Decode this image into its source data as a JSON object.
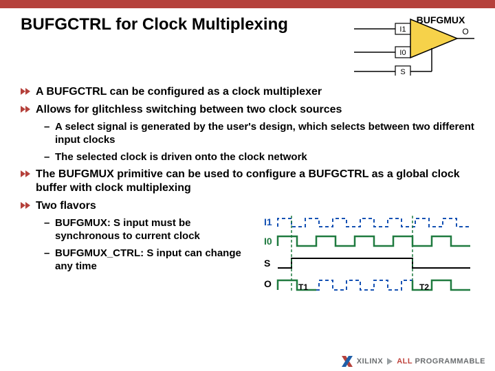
{
  "header": {
    "title": "BUFGCTRL for Clock Multiplexing"
  },
  "mux": {
    "label": "BUFGMUX",
    "i1": "I1",
    "i0": "I0",
    "o": "O",
    "s": "S"
  },
  "bullets": {
    "b1": "A BUFGCTRL can be configured as a clock multiplexer",
    "b2": "Allows for glitchless switching between two clock sources",
    "b2s1": "A select signal is generated by the user's design, which selects between two different input clocks",
    "b2s2": "The selected clock is driven onto the clock network",
    "b3": "The BUFGMUX primitive can be used to configure a BUFGCTRL as a global clock buffer with  clock multiplexing",
    "b4": "Two flavors",
    "b4s1": "BUFGMUX: S input must be synchronous to current clock",
    "b4s2": "BUFGMUX_CTRL: S input can change any time"
  },
  "timing": {
    "i1": "I1",
    "i0": "I0",
    "s": "S",
    "o": "O",
    "t1": "T1",
    "t2": "T2"
  },
  "footer": {
    "brand": "XILINX",
    "tag_prefix": "ALL",
    "tag_suffix": "PROGRAMMABLE"
  },
  "colors": {
    "accent": "#b5413b",
    "timing_green": "#1f7a3f",
    "timing_dash": "#1350b3"
  }
}
